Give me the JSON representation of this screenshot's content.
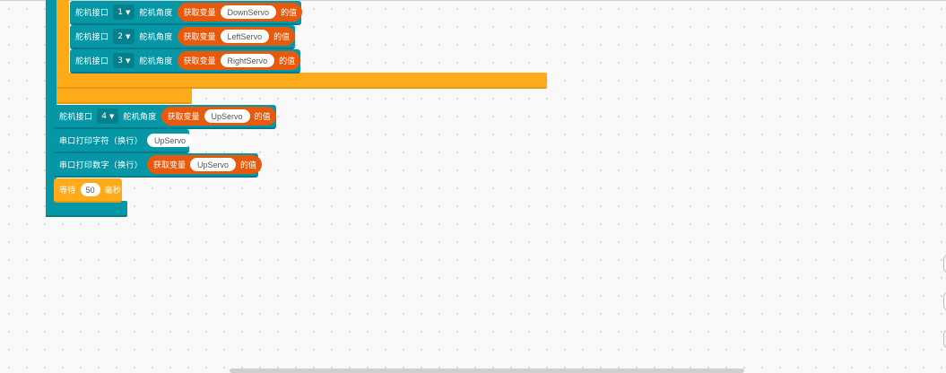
{
  "blocks": {
    "servo_label": "舵机接口",
    "angle_label": "舵机角度",
    "get_var_label": "获取变量",
    "value_suffix": "的值",
    "servo_rows": [
      {
        "port": "1",
        "variable": "DownServo"
      },
      {
        "port": "2",
        "variable": "LeftServo"
      },
      {
        "port": "3",
        "variable": "RightServo"
      }
    ],
    "up_row": {
      "port": "4",
      "variable": "UpServo"
    },
    "print_string": {
      "label": "串口打印字符（换行）",
      "value": "UpServo"
    },
    "print_number": {
      "label": "串口打印数字（换行）",
      "variable": "UpServo"
    },
    "wait": {
      "label": "等待",
      "value": "50",
      "unit": "毫秒"
    }
  },
  "icons": {
    "dropdown": "caret-down-icon"
  },
  "colors": {
    "teal": "#0597a6",
    "orange": "#ffab19",
    "reporter": "#e8590c",
    "background": "#f9f9f9"
  }
}
